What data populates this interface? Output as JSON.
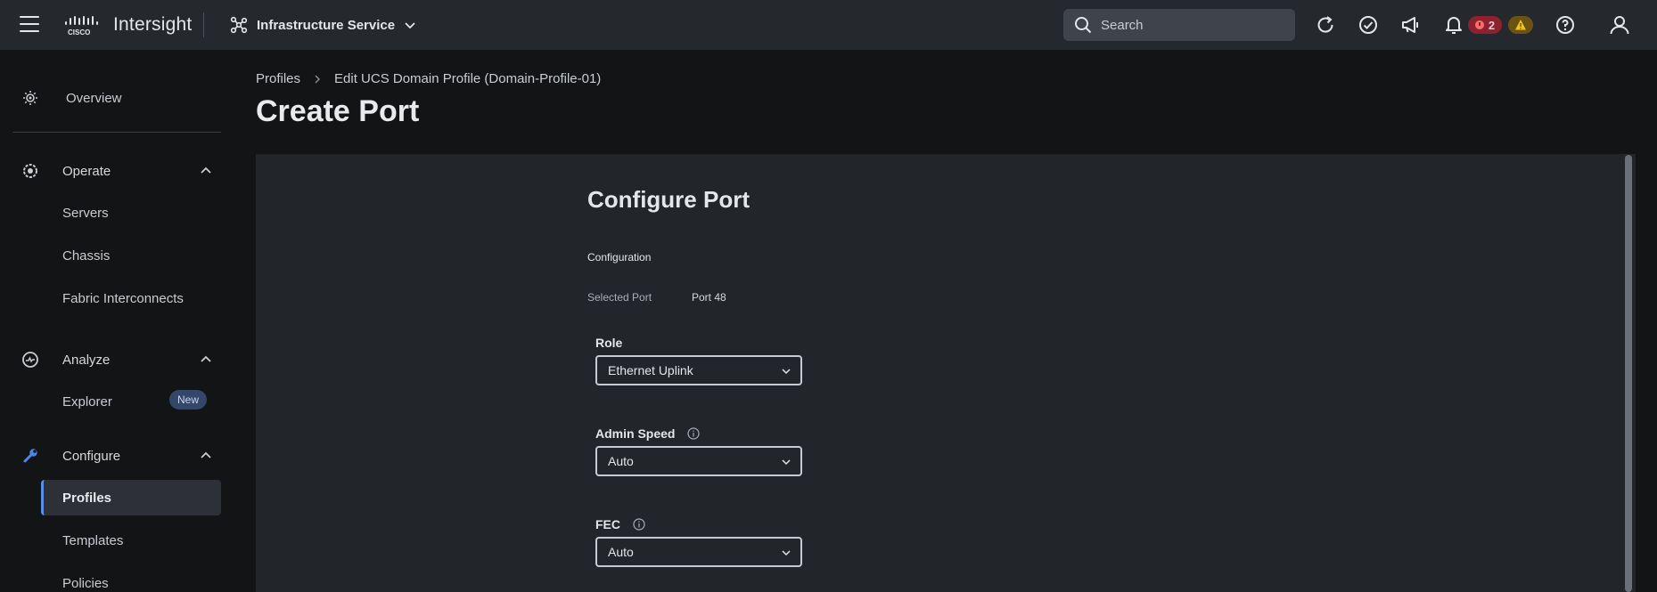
{
  "header": {
    "brand": "Intersight",
    "service": "Infrastructure Service",
    "search_placeholder": "Search",
    "critical_count": "2"
  },
  "sidebar": {
    "overview": "Overview",
    "operate": {
      "label": "Operate",
      "items": [
        "Servers",
        "Chassis",
        "Fabric Interconnects"
      ]
    },
    "analyze": {
      "label": "Analyze",
      "items": [
        "Explorer"
      ],
      "explorer_badge": "New"
    },
    "configure": {
      "label": "Configure",
      "items": [
        "Profiles",
        "Templates",
        "Policies"
      ],
      "active": "Profiles"
    }
  },
  "breadcrumb": [
    "Profiles",
    "Edit UCS Domain Profile (Domain-Profile-01)"
  ],
  "page_title": "Create Port",
  "form": {
    "title": "Configure Port",
    "section": "Configuration",
    "selected_port_label": "Selected Port",
    "selected_port_value": "Port 48",
    "role": {
      "label": "Role",
      "value": "Ethernet Uplink"
    },
    "admin_speed": {
      "label": "Admin Speed",
      "value": "Auto"
    },
    "fec": {
      "label": "FEC",
      "value": "Auto"
    }
  },
  "colors": {
    "topbar": "#25282d",
    "background": "#131416",
    "panel": "#22262b",
    "accent": "#5b8fe6",
    "critical": "#8c2230",
    "warning": "#6b5212"
  },
  "icons": [
    "menu-icon",
    "cisco-logo",
    "network-icon",
    "chevron-down-icon",
    "search-icon",
    "refresh-icon",
    "check-circle-icon",
    "megaphone-icon",
    "bell-icon",
    "warning-icon",
    "help-icon",
    "user-icon",
    "overview-icon",
    "operate-icon",
    "analyze-icon",
    "configure-icon",
    "info-icon"
  ]
}
